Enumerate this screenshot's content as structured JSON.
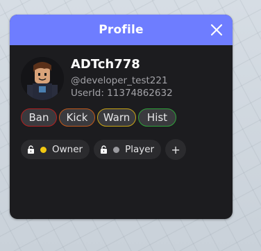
{
  "header": {
    "title": "Profile",
    "accent_color": "#6e7dff"
  },
  "profile": {
    "display_name": "ADTch778",
    "username": "@developer_test221",
    "userid_label": "UserId: ",
    "userid_value": "11374862632"
  },
  "actions": [
    {
      "label": "Ban",
      "border_color": "#b42020"
    },
    {
      "label": "Kick",
      "border_color": "#c25a1c"
    },
    {
      "label": "Warn",
      "border_color": "#c9a516"
    },
    {
      "label": "Hist",
      "border_color": "#2fa33a"
    }
  ],
  "roles": [
    {
      "label": "Owner",
      "dot_color": "#f2c811",
      "icon": "lock-icon"
    },
    {
      "label": "Player",
      "dot_color": "#9b9ba0",
      "icon": "lock-icon"
    }
  ],
  "add_role_label": "+",
  "icons": {
    "close": "close-icon",
    "avatar": "avatar-image"
  }
}
